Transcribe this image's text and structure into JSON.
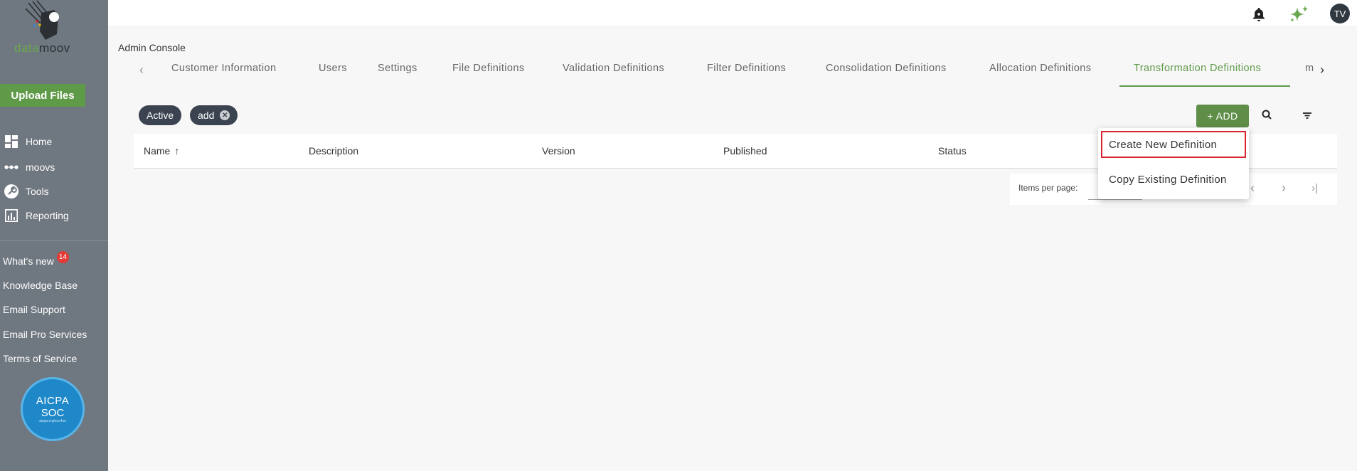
{
  "sidebar": {
    "logo_text_1": "data",
    "logo_text_2": "moov",
    "upload_label": "Upload Files",
    "nav": [
      {
        "label": "Home",
        "icon": "dashboard-icon"
      },
      {
        "label": "moovs",
        "icon": "dots-icon"
      },
      {
        "label": "Tools",
        "icon": "wrench-icon"
      },
      {
        "label": "Reporting",
        "icon": "chart-icon"
      }
    ],
    "links": {
      "whats_new": "What's new",
      "whats_new_badge": "14",
      "knowledge_base": "Knowledge Base",
      "email_support": "Email Support",
      "email_pro": "Email Pro Services",
      "terms": "Terms of Service"
    },
    "aicpa": {
      "line1": "AICPA",
      "line2": "SOC",
      "line3": "aicpa.org/soc4so"
    }
  },
  "header": {
    "avatar_initials": "TV"
  },
  "page_title": "Admin Console",
  "tabs": [
    {
      "label": "Customer Information"
    },
    {
      "label": "Users"
    },
    {
      "label": "Settings"
    },
    {
      "label": "File Definitions"
    },
    {
      "label": "Validation Definitions"
    },
    {
      "label": "Filter Definitions"
    },
    {
      "label": "Consolidation Definitions"
    },
    {
      "label": "Allocation Definitions"
    },
    {
      "label": "Transformation Definitions",
      "active": true
    },
    {
      "label": "m"
    }
  ],
  "chips": {
    "active": "Active",
    "add": "add"
  },
  "toolbar": {
    "add_label": "+ ADD"
  },
  "table": {
    "columns": [
      "Name",
      "Description",
      "Version",
      "Published",
      "Status"
    ],
    "sort_icon": "↑"
  },
  "paginator": {
    "items_per_page": "Items per page:"
  },
  "menu": {
    "create_new": "Create New Definition",
    "copy_existing": "Copy Existing Definition"
  },
  "colors": {
    "accent": "#5f9a48",
    "sidebar": "#6f7780",
    "highlight": "#d9262e"
  }
}
